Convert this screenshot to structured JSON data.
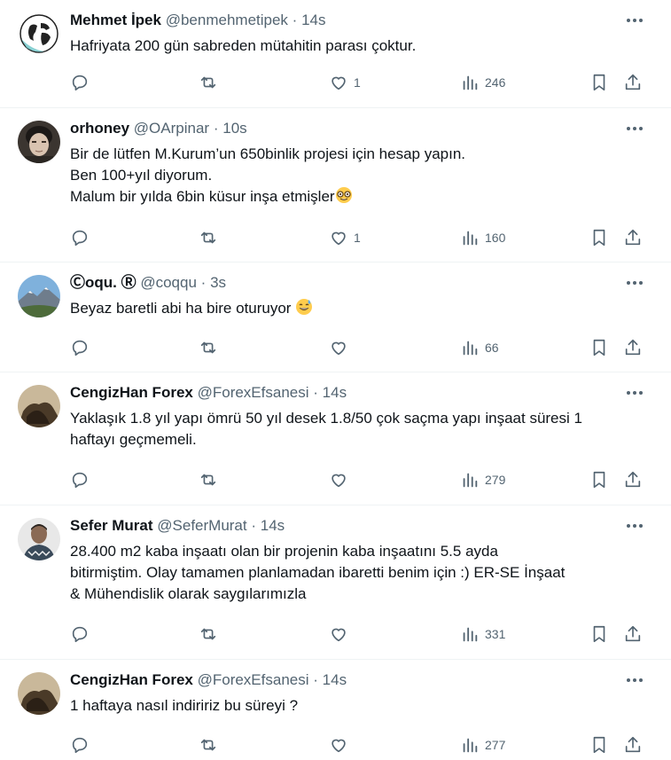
{
  "tweets": [
    {
      "name": "Mehmet İpek",
      "handle": "@benmehmetipek",
      "time": "14s",
      "lines": [
        "Hafriyata 200 gün sabreden mütahitin parası çoktur."
      ],
      "likes": "1",
      "views": "246"
    },
    {
      "name": "orhoney",
      "handle": "@OArpinar",
      "time": "10s",
      "lines": [
        "Bir de lütfen M.Kurum’un 650binlik projesi için hesap yapın.",
        "Ben 100+yıl diyorum.",
        "Malum bir yılda 6bin küsur inşa etmişler"
      ],
      "likes": "1",
      "views": "160",
      "emoji": "nerd-face"
    },
    {
      "name": "Ⓒoqu. Ⓡ",
      "handle": "@coqqu",
      "time": "3s",
      "lines": [
        "Beyaz baretli abi ha bire oturuyor"
      ],
      "views": "66",
      "emoji": "grinning-sweat"
    },
    {
      "name": "CengizHan Forex",
      "handle": "@ForexEfsanesi",
      "time": "14s",
      "lines": [
        "Yaklaşık 1.8 yıl yapı ömrü 50 yıl desek 1.8/50 çok saçma yapı inşaat süresi 1",
        "haftayı geçmemeli."
      ],
      "views": "279"
    },
    {
      "name": "Sefer Murat",
      "handle": "@SeferMurat",
      "time": "14s",
      "lines": [
        "28.400 m2 kaba inşaatı olan bir projenin kaba inşaatını 5.5 ayda",
        "bitirmiştim. Olay tamamen planlamadan ibaretti benim için :) ER-SE İnşaat",
        "& Mühendislik olarak saygılarımızla"
      ],
      "views": "331"
    },
    {
      "name": "CengizHan Forex",
      "handle": "@ForexEfsanesi",
      "time": "14s",
      "lines": [
        "1 haftaya nasıl indiririz bu süreyi ?"
      ],
      "views": "277"
    }
  ],
  "separator": "·",
  "colors": {
    "text": "#0f1419",
    "secondary": "#536471",
    "border": "#eff3f4"
  }
}
